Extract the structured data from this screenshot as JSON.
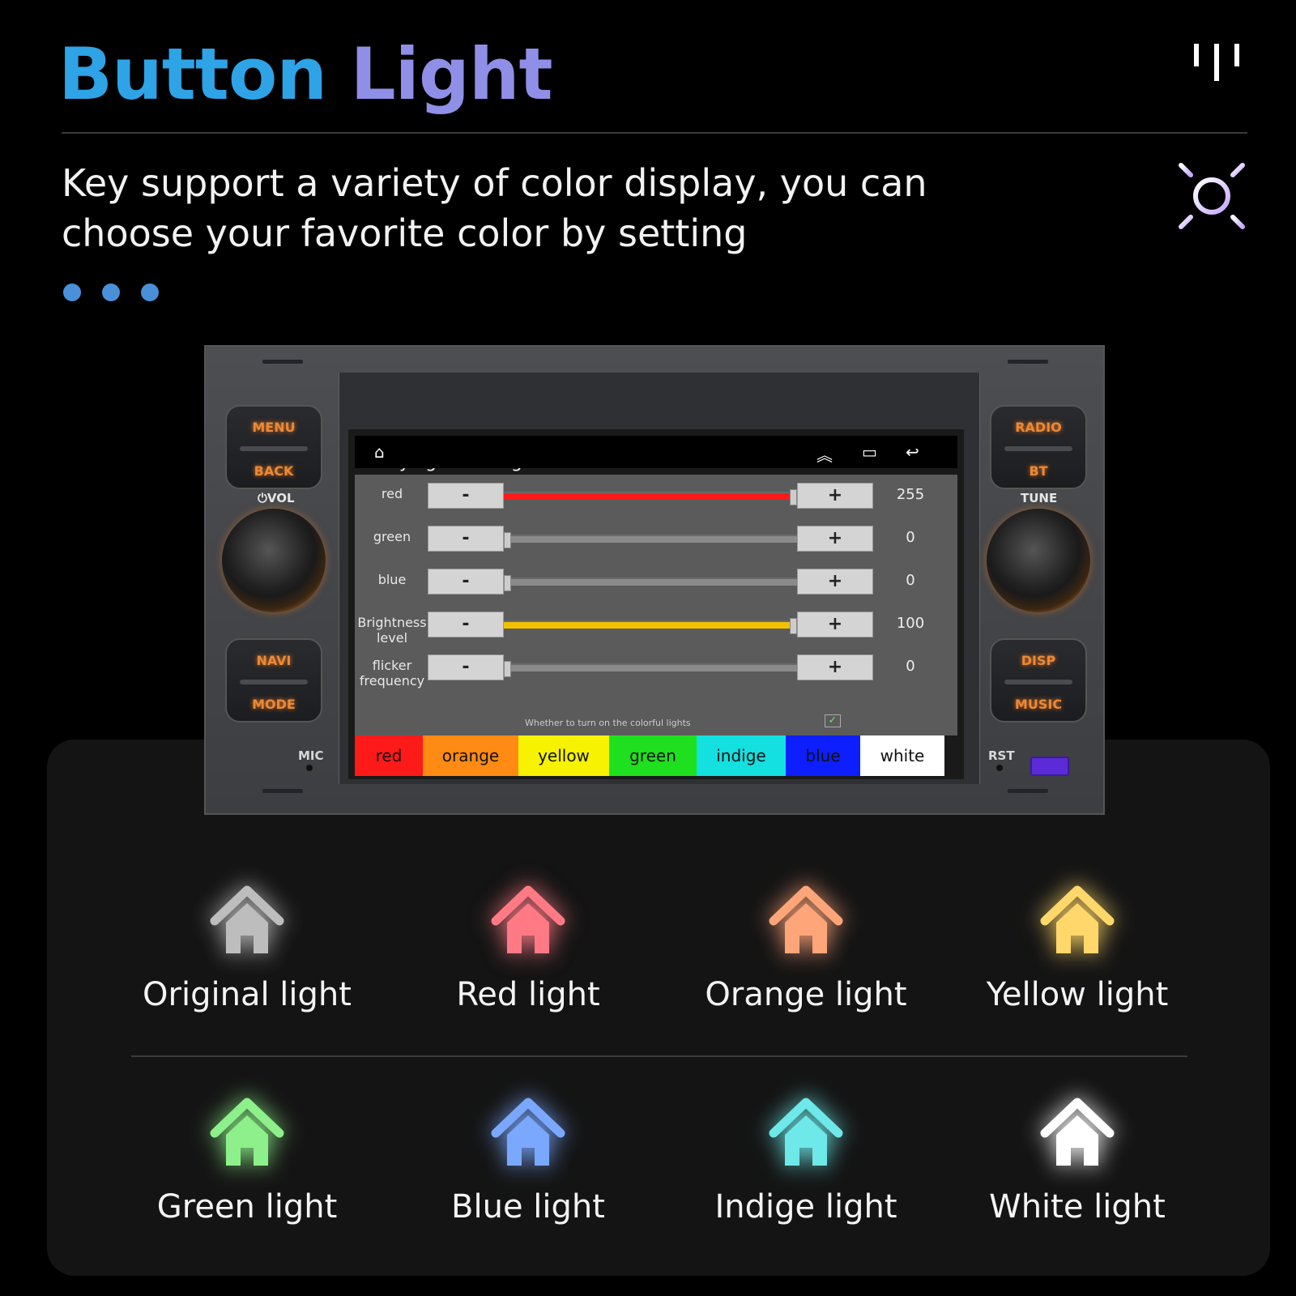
{
  "header": {
    "title_word1": "Button",
    "title_word2": "Light",
    "subtitle": "Key support a variety of color display, you can choose your favorite color by setting"
  },
  "icons": {
    "brand": "brand-mark-icon",
    "sun": "sun-icon",
    "home": "home-icon"
  },
  "head_unit": {
    "left_buttons": [
      {
        "top": "MENU",
        "bottom": "BACK"
      },
      {
        "top": "NAVI",
        "bottom": "MODE"
      }
    ],
    "right_buttons": [
      {
        "top": "RADIO",
        "bottom": "BT"
      },
      {
        "top": "DISP",
        "bottom": "MUSIC"
      }
    ],
    "left_knob_label": "⏻VOL",
    "right_knob_label": "TUNE",
    "mic_label": "MIC",
    "rst_label": "RST"
  },
  "screen": {
    "settings_title": "Key light settings",
    "rows": [
      {
        "name": "red",
        "value": 255,
        "max": 255,
        "color": "#ff1a1a"
      },
      {
        "name": "green",
        "value": 0,
        "max": 255,
        "color": "#2ecc40"
      },
      {
        "name": "blue",
        "value": 0,
        "max": 255,
        "color": "#1f4fff"
      },
      {
        "name": "Brightness level",
        "value": 100,
        "max": 100,
        "color": "#f2c200"
      },
      {
        "name": "flicker frequency",
        "value": 0,
        "max": 100,
        "color": "#cccccc"
      }
    ],
    "minus_label": "-",
    "plus_label": "+",
    "toggle_note": "Whether to turn on the colorful lights",
    "toggle_checked": true,
    "color_options": [
      {
        "label": "red",
        "bg": "#ff1a1a"
      },
      {
        "label": "orange",
        "bg": "#ff8a14"
      },
      {
        "label": "yellow",
        "bg": "#f6f200"
      },
      {
        "label": "green",
        "bg": "#1fe01f"
      },
      {
        "label": "indige",
        "bg": "#14e0e0"
      },
      {
        "label": "blue",
        "bg": "#0d1fff"
      },
      {
        "label": "white",
        "bg": "#ffffff"
      }
    ]
  },
  "lights": [
    {
      "label": "Original light",
      "color": "#bdbdbd"
    },
    {
      "label": "Red light",
      "color": "#ff7a85"
    },
    {
      "label": "Orange light",
      "color": "#ffa57a"
    },
    {
      "label": "Yellow light",
      "color": "#ffd76a"
    },
    {
      "label": "Green light",
      "color": "#8df08a"
    },
    {
      "label": "Blue light",
      "color": "#7aa8ff"
    },
    {
      "label": "Indige light",
      "color": "#6ee8e8"
    },
    {
      "label": "White light",
      "color": "#ffffff"
    }
  ]
}
